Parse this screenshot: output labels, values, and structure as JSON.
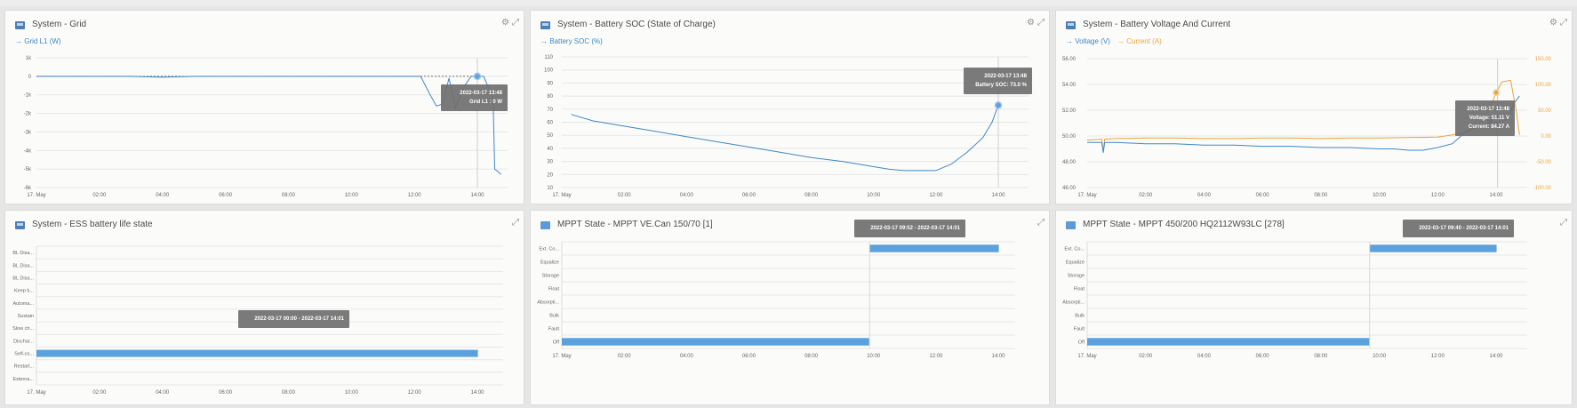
{
  "colors": {
    "blue": "#3e87c6",
    "orange": "#e9a53d",
    "bar": "#5aa1dd",
    "tooltip_bg": "#6f6f6f",
    "grid": "#e7e7e7"
  },
  "icons": {
    "settings": "gear-icon",
    "expand": "expand-icon"
  },
  "panels": {
    "grid": {
      "title": "System - Grid",
      "legend": [
        "Grid L1 (W)"
      ],
      "tooltip": {
        "time": "2022-03-17 13:48",
        "line1": "Grid L1 : 0 W"
      }
    },
    "soc": {
      "title": "System - Battery SOC (State of Charge)",
      "legend": [
        "Battery SOC (%)"
      ],
      "tooltip": {
        "time": "2022-03-17 13:48",
        "line1": "Battery SOC: 73.0 %"
      }
    },
    "voltage": {
      "title": "System - Battery Voltage And Current",
      "legend": [
        "Voltage (V)",
        "Current (A)"
      ],
      "tooltip": {
        "time": "2022-03-17 13:48",
        "line1": "Voltage: 51.11 V",
        "line2": "Current: 84.27 A"
      }
    },
    "ess": {
      "title": "System - ESS battery life state",
      "tooltip": {
        "line1": "2022-03-17 00:00 - 2022-03-17 14:01"
      }
    },
    "mppt1": {
      "title": "MPPT State - MPPT VE.Can 150/70 [1]",
      "tooltip": {
        "line1": "2022-03-17 09:52 - 2022-03-17 14:01"
      }
    },
    "mppt2": {
      "title": "MPPT State - MPPT 450/200 HQ2112W93LC [278]",
      "tooltip": {
        "line1": "2022-03-17 09:40 - 2022-03-17 14:01"
      }
    }
  },
  "chart_data": [
    {
      "type": "line",
      "title": "System - Grid",
      "x_ticks": [
        "17. May",
        "02:00",
        "04:00",
        "06:00",
        "08:00",
        "10:00",
        "12:00",
        "14:00"
      ],
      "y_ticks": [
        "1k",
        "0",
        "-1k",
        "-2k",
        "-3k",
        "-4k",
        "-5k",
        "-6k"
      ],
      "ylim": [
        -6000,
        1000
      ],
      "series": [
        {
          "name": "Grid L1 (W)",
          "x": [
            0,
            1,
            2,
            3,
            4,
            5,
            6,
            7,
            8,
            9,
            10,
            11,
            12,
            12.2,
            12.5,
            12.7,
            12.9,
            13.1,
            13.3,
            13.6,
            13.8,
            14.2,
            14.5,
            14.55,
            14.7,
            14.75
          ],
          "y": [
            0,
            0,
            0,
            0,
            -50,
            0,
            0,
            0,
            0,
            0,
            0,
            0,
            0,
            0,
            -1000,
            -1600,
            -1500,
            -100,
            -1700,
            -500,
            0,
            0,
            -1200,
            -5000,
            -5200,
            -5300
          ]
        }
      ]
    },
    {
      "type": "line",
      "title": "System - Battery SOC (State of Charge)",
      "x_ticks": [
        "17. May",
        "02:00",
        "04:00",
        "06:00",
        "08:00",
        "10:00",
        "12:00",
        "14:00"
      ],
      "y_ticks": [
        "110",
        "100",
        "90",
        "80",
        "70",
        "60",
        "50",
        "40",
        "30",
        "20",
        "10"
      ],
      "ylim": [
        10,
        110
      ],
      "series": [
        {
          "name": "Battery SOC (%)",
          "x": [
            0.3,
            1,
            2,
            3,
            4,
            5,
            6,
            7,
            8,
            9,
            10,
            10.5,
            11,
            11.5,
            12,
            12.5,
            13,
            13.5,
            13.8,
            14.0
          ],
          "y": [
            66,
            61,
            57,
            53,
            49,
            45,
            41,
            37,
            33,
            30,
            26,
            24,
            23,
            23,
            23,
            28,
            37,
            48,
            60,
            73
          ]
        }
      ]
    },
    {
      "type": "line",
      "title": "System - Battery Voltage And Current",
      "x_ticks": [
        "17. May",
        "02:00",
        "04:00",
        "06:00",
        "08:00",
        "10:00",
        "12:00",
        "14:00"
      ],
      "y_ticks_left": [
        "56.00",
        "54.00",
        "52.00",
        "50.00",
        "48.00",
        "46.00"
      ],
      "y_ticks_right": [
        "150.00",
        "100.00",
        "50.00",
        "0.00",
        "-50.00",
        "-100.00"
      ],
      "ylim_left": [
        46,
        56
      ],
      "ylim_right": [
        -100,
        150
      ],
      "series": [
        {
          "name": "Voltage (V)",
          "axis": "left",
          "x": [
            0,
            0.5,
            0.55,
            0.6,
            1,
            2,
            3,
            4,
            5,
            6,
            7,
            8,
            9,
            10,
            10.5,
            11,
            11.5,
            12,
            12.5,
            12.8,
            13.0,
            13.5,
            13.8,
            14.1,
            14.4,
            14.6,
            14.8
          ],
          "y": [
            49.5,
            49.5,
            48.7,
            49.5,
            49.5,
            49.4,
            49.4,
            49.3,
            49.3,
            49.2,
            49.2,
            49.1,
            49.1,
            49.0,
            49.0,
            48.9,
            48.9,
            49.1,
            49.4,
            50.0,
            50.4,
            50.8,
            51.0,
            51.1,
            51.3,
            52.5,
            53.1
          ]
        },
        {
          "name": "Current (A)",
          "axis": "right",
          "x": [
            0,
            0.5,
            0.55,
            0.6,
            1,
            2,
            3,
            4,
            5,
            6,
            7,
            8,
            9,
            10,
            11,
            12,
            12.5,
            13.0,
            13.5,
            13.8,
            14.0,
            14.2,
            14.5,
            14.7,
            14.8
          ],
          "y": [
            -8,
            -6,
            -30,
            -6,
            -5,
            -4,
            -4,
            -5,
            -5,
            -4,
            -4,
            -5,
            -4,
            -4,
            -3,
            -2,
            2,
            6,
            30,
            55,
            84,
            105,
            108,
            45,
            2
          ]
        }
      ]
    },
    {
      "type": "bar",
      "title": "System - ESS battery life state",
      "categories": [
        "BL Disa...",
        "BL Disa...",
        "BL Disa...",
        "Keep b...",
        "Automa...",
        "Sustain",
        "Slow ch...",
        "Dischar...",
        "Self-co...",
        "Restart...",
        "Externa..."
      ],
      "x_ticks": [
        "17. May",
        "02:00",
        "04:00",
        "06:00",
        "08:00",
        "10:00",
        "12:00",
        "14:00"
      ],
      "bars": [
        {
          "category": "Self-co...",
          "start": "00:00",
          "end": "14:01"
        }
      ]
    },
    {
      "type": "bar",
      "title": "MPPT State - MPPT VE.Can 150/70 [1]",
      "categories": [
        "Ext. Co...",
        "Equalize",
        "Storage",
        "Float",
        "Absorpti...",
        "Bulk",
        "Fault",
        "Off"
      ],
      "x_ticks": [
        "17. May",
        "02:00",
        "04:00",
        "06:00",
        "08:00",
        "10:00",
        "12:00",
        "14:00"
      ],
      "bars": [
        {
          "category": "Off",
          "start": "00:00",
          "end": "09:52"
        },
        {
          "category": "Ext. Co...",
          "start": "09:52",
          "end": "14:01"
        }
      ]
    },
    {
      "type": "bar",
      "title": "MPPT State - MPPT 450/200 HQ2112W93LC [278]",
      "categories": [
        "Ext. Co...",
        "Equalize",
        "Storage",
        "Float",
        "Absorpti...",
        "Bulk",
        "Fault",
        "Off"
      ],
      "x_ticks": [
        "17. May",
        "02:00",
        "04:00",
        "06:00",
        "08:00",
        "10:00",
        "12:00",
        "14:00"
      ],
      "bars": [
        {
          "category": "Off",
          "start": "00:00",
          "end": "09:40"
        },
        {
          "category": "Ext. Co...",
          "start": "09:40",
          "end": "14:01"
        }
      ]
    }
  ]
}
